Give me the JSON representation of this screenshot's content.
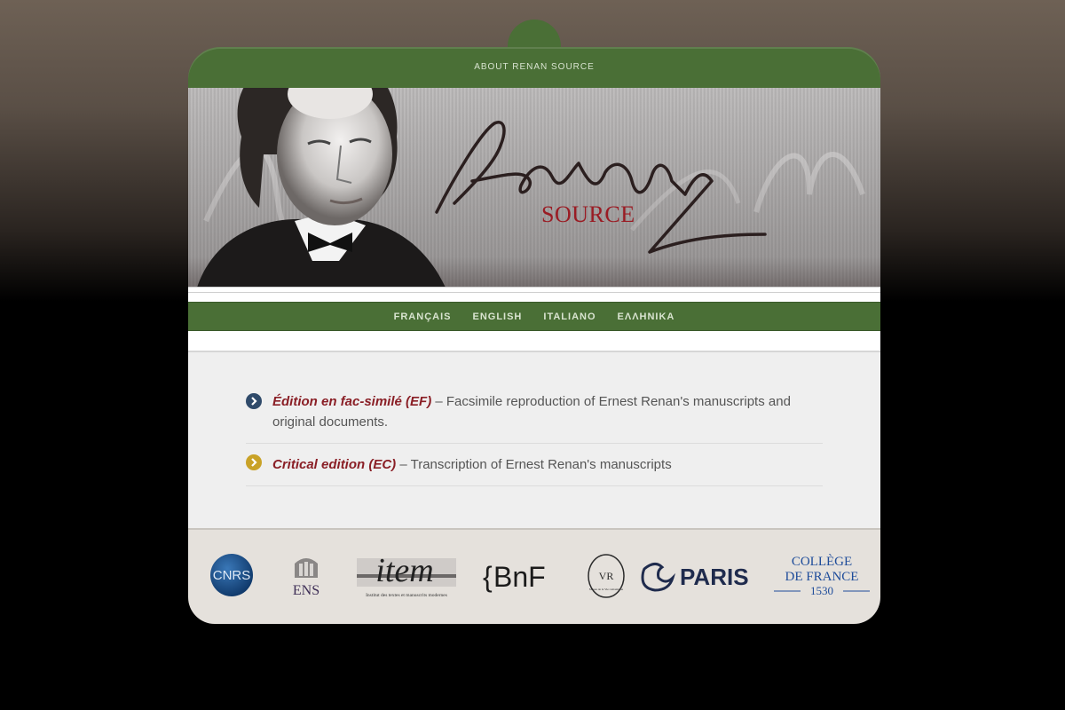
{
  "header": {
    "about_link": "ABOUT RENAN SOURCE",
    "banner_source": "SOURCE"
  },
  "languages": [
    {
      "label": "FRANÇAIS"
    },
    {
      "label": "ENGLISH"
    },
    {
      "label": "ITALIANO"
    },
    {
      "label": "ΕΛΛΗΝΙΚΑ"
    }
  ],
  "editions": [
    {
      "title": "Édition en fac-similé (EF)",
      "description": " – Facsimile reproduction of Ernest Renan's manuscripts and original documents.",
      "bullet_color": "#2f4a6a",
      "icon": "chevron-right-icon"
    },
    {
      "title": "Critical edition (EC)",
      "description": " – Transcription of Ernest Renan's manuscripts",
      "bullet_color": "#c9a227",
      "icon": "chevron-right-icon"
    }
  ],
  "partners": [
    {
      "name": "cnrs",
      "label": "CNRS"
    },
    {
      "name": "ens",
      "label": "ENS"
    },
    {
      "name": "item",
      "label": "item",
      "sub": "Institut des textes et manuscrits modernes"
    },
    {
      "name": "bnf",
      "label": "BnF"
    },
    {
      "name": "musee-vie-romantique",
      "label": "VR",
      "sub": "Musée de la Vie romantique"
    },
    {
      "name": "paris",
      "label": "PARIS"
    },
    {
      "name": "college-de-france",
      "label": "COLLÈGE",
      "label2": "DE FRANCE",
      "year": "1530"
    }
  ],
  "colors": {
    "green": "#4a6f36",
    "title_red": "#8a1f26",
    "source_red": "#9a1c24"
  }
}
